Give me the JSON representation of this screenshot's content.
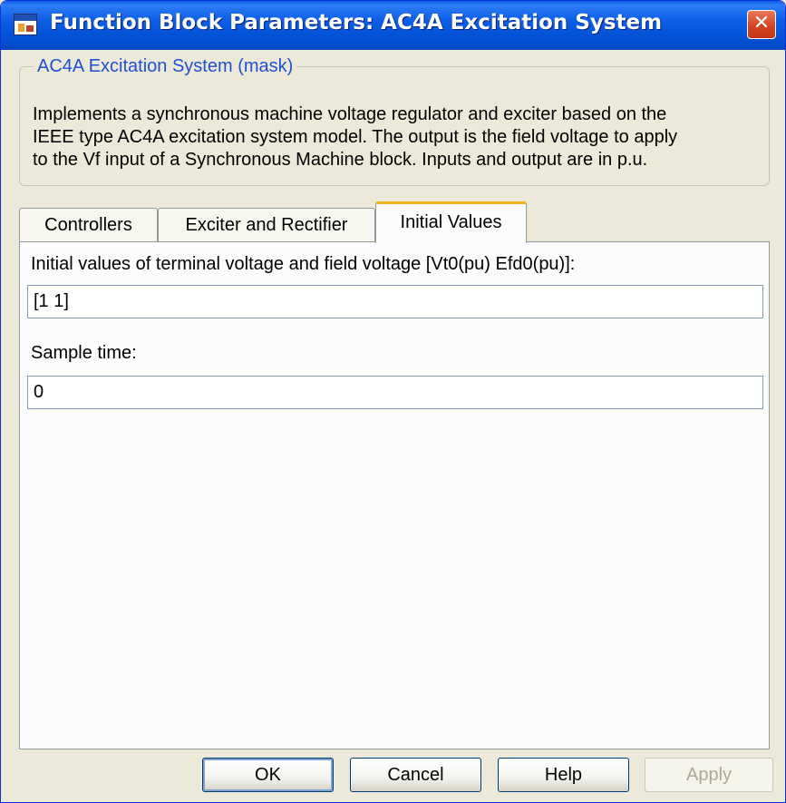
{
  "window": {
    "title": "Function Block Parameters: AC4A Excitation System",
    "close_symbol": "✕"
  },
  "mask": {
    "legend": "AC4A Excitation System (mask)",
    "description_lines": [
      "Implements a synchronous machine voltage regulator and exciter based on the",
      "IEEE type AC4A excitation system model. The output is the field voltage to apply",
      "to the Vf input of a Synchronous Machine block. Inputs and output are in p.u."
    ]
  },
  "tabs": [
    {
      "label": "Controllers",
      "active": false
    },
    {
      "label": "Exciter and Rectifier",
      "active": false
    },
    {
      "label": "Initial Values",
      "active": true
    }
  ],
  "fields": [
    {
      "label": "Initial values of terminal voltage and field voltage [Vt0(pu) Efd0(pu)]:",
      "value": "[1 1]"
    },
    {
      "label": "Sample time:",
      "value": "0"
    }
  ],
  "buttons": {
    "ok": "OK",
    "cancel": "Cancel",
    "help": "Help",
    "apply": "Apply"
  },
  "icons": {
    "window_icon": "simulink-block-icon",
    "close": "close-icon"
  }
}
